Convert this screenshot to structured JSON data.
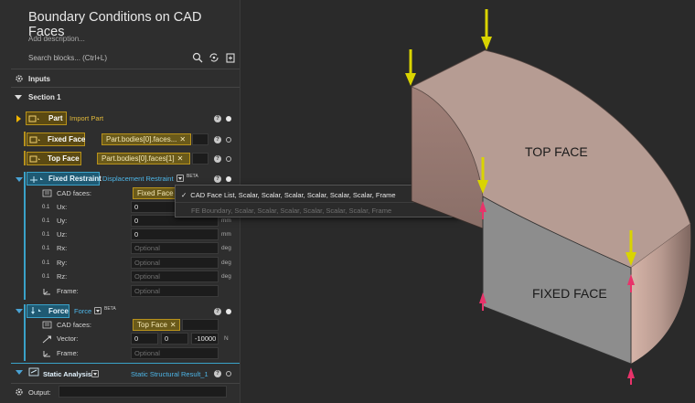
{
  "panel": {
    "title": "Boundary Conditions on CAD Faces",
    "description_placeholder": "Add description...",
    "search_placeholder": "Search blocks... (Ctrl+L)",
    "inputs_label": "Inputs",
    "section_label": "Section 1",
    "output_label": "Output:"
  },
  "blocks": {
    "part": {
      "type": "Part",
      "link": "Import Part",
      "help": "?"
    },
    "fixed_face": {
      "type": "Fixed Face",
      "value": "Part.bodies[0].faces...",
      "help": "?"
    },
    "top_face": {
      "type": "Top Face",
      "value": "Part.bodies[0].faces[1]",
      "help": "?"
    },
    "fixed_restraint": {
      "type": "Fixed Restraint",
      "link": "Displacement Restraint",
      "beta": "BETA",
      "help": "?",
      "fields": [
        {
          "label": "CAD faces:",
          "value": "Fixed Face",
          "unit": ""
        },
        {
          "label": "Ux:",
          "value": "0",
          "unit": "mm"
        },
        {
          "label": "Uy:",
          "value": "0",
          "unit": "mm"
        },
        {
          "label": "Uz:",
          "value": "0",
          "unit": "mm"
        },
        {
          "label": "Rx:",
          "placeholder": "Optional",
          "unit": "deg"
        },
        {
          "label": "Ry:",
          "placeholder": "Optional",
          "unit": "deg"
        },
        {
          "label": "Rz:",
          "placeholder": "Optional",
          "unit": "deg"
        },
        {
          "label": "Frame:",
          "placeholder": "Optional",
          "unit": ""
        }
      ]
    },
    "force": {
      "type": "Force",
      "link": "Force",
      "beta": "BETA",
      "help": "?",
      "cad_label": "CAD faces:",
      "cad_value": "Top Face",
      "vector_label": "Vector:",
      "vector": [
        "0",
        "0",
        "-10000"
      ],
      "vector_unit": "N",
      "frame_label": "Frame:",
      "frame_placeholder": "Optional"
    },
    "analysis": {
      "type": "Static Analysis",
      "link": "Static Structural Result_1",
      "help": "?"
    }
  },
  "dropdown": {
    "selected": "CAD Face List, Scalar, Scalar, Scalar, Scalar, Scalar, Scalar, Frame",
    "other": "FE Boundary, Scalar, Scalar, Scalar, Scalar, Scalar, Scalar, Frame"
  },
  "viewport": {
    "top_face_label": "TOP FACE",
    "fixed_face_label": "FIXED FACE",
    "colors": {
      "top_face": "#b49a92",
      "side_face": "#8e8e8e",
      "force_arrow": "#d9d400",
      "support_arrow": "#e8336a"
    }
  }
}
